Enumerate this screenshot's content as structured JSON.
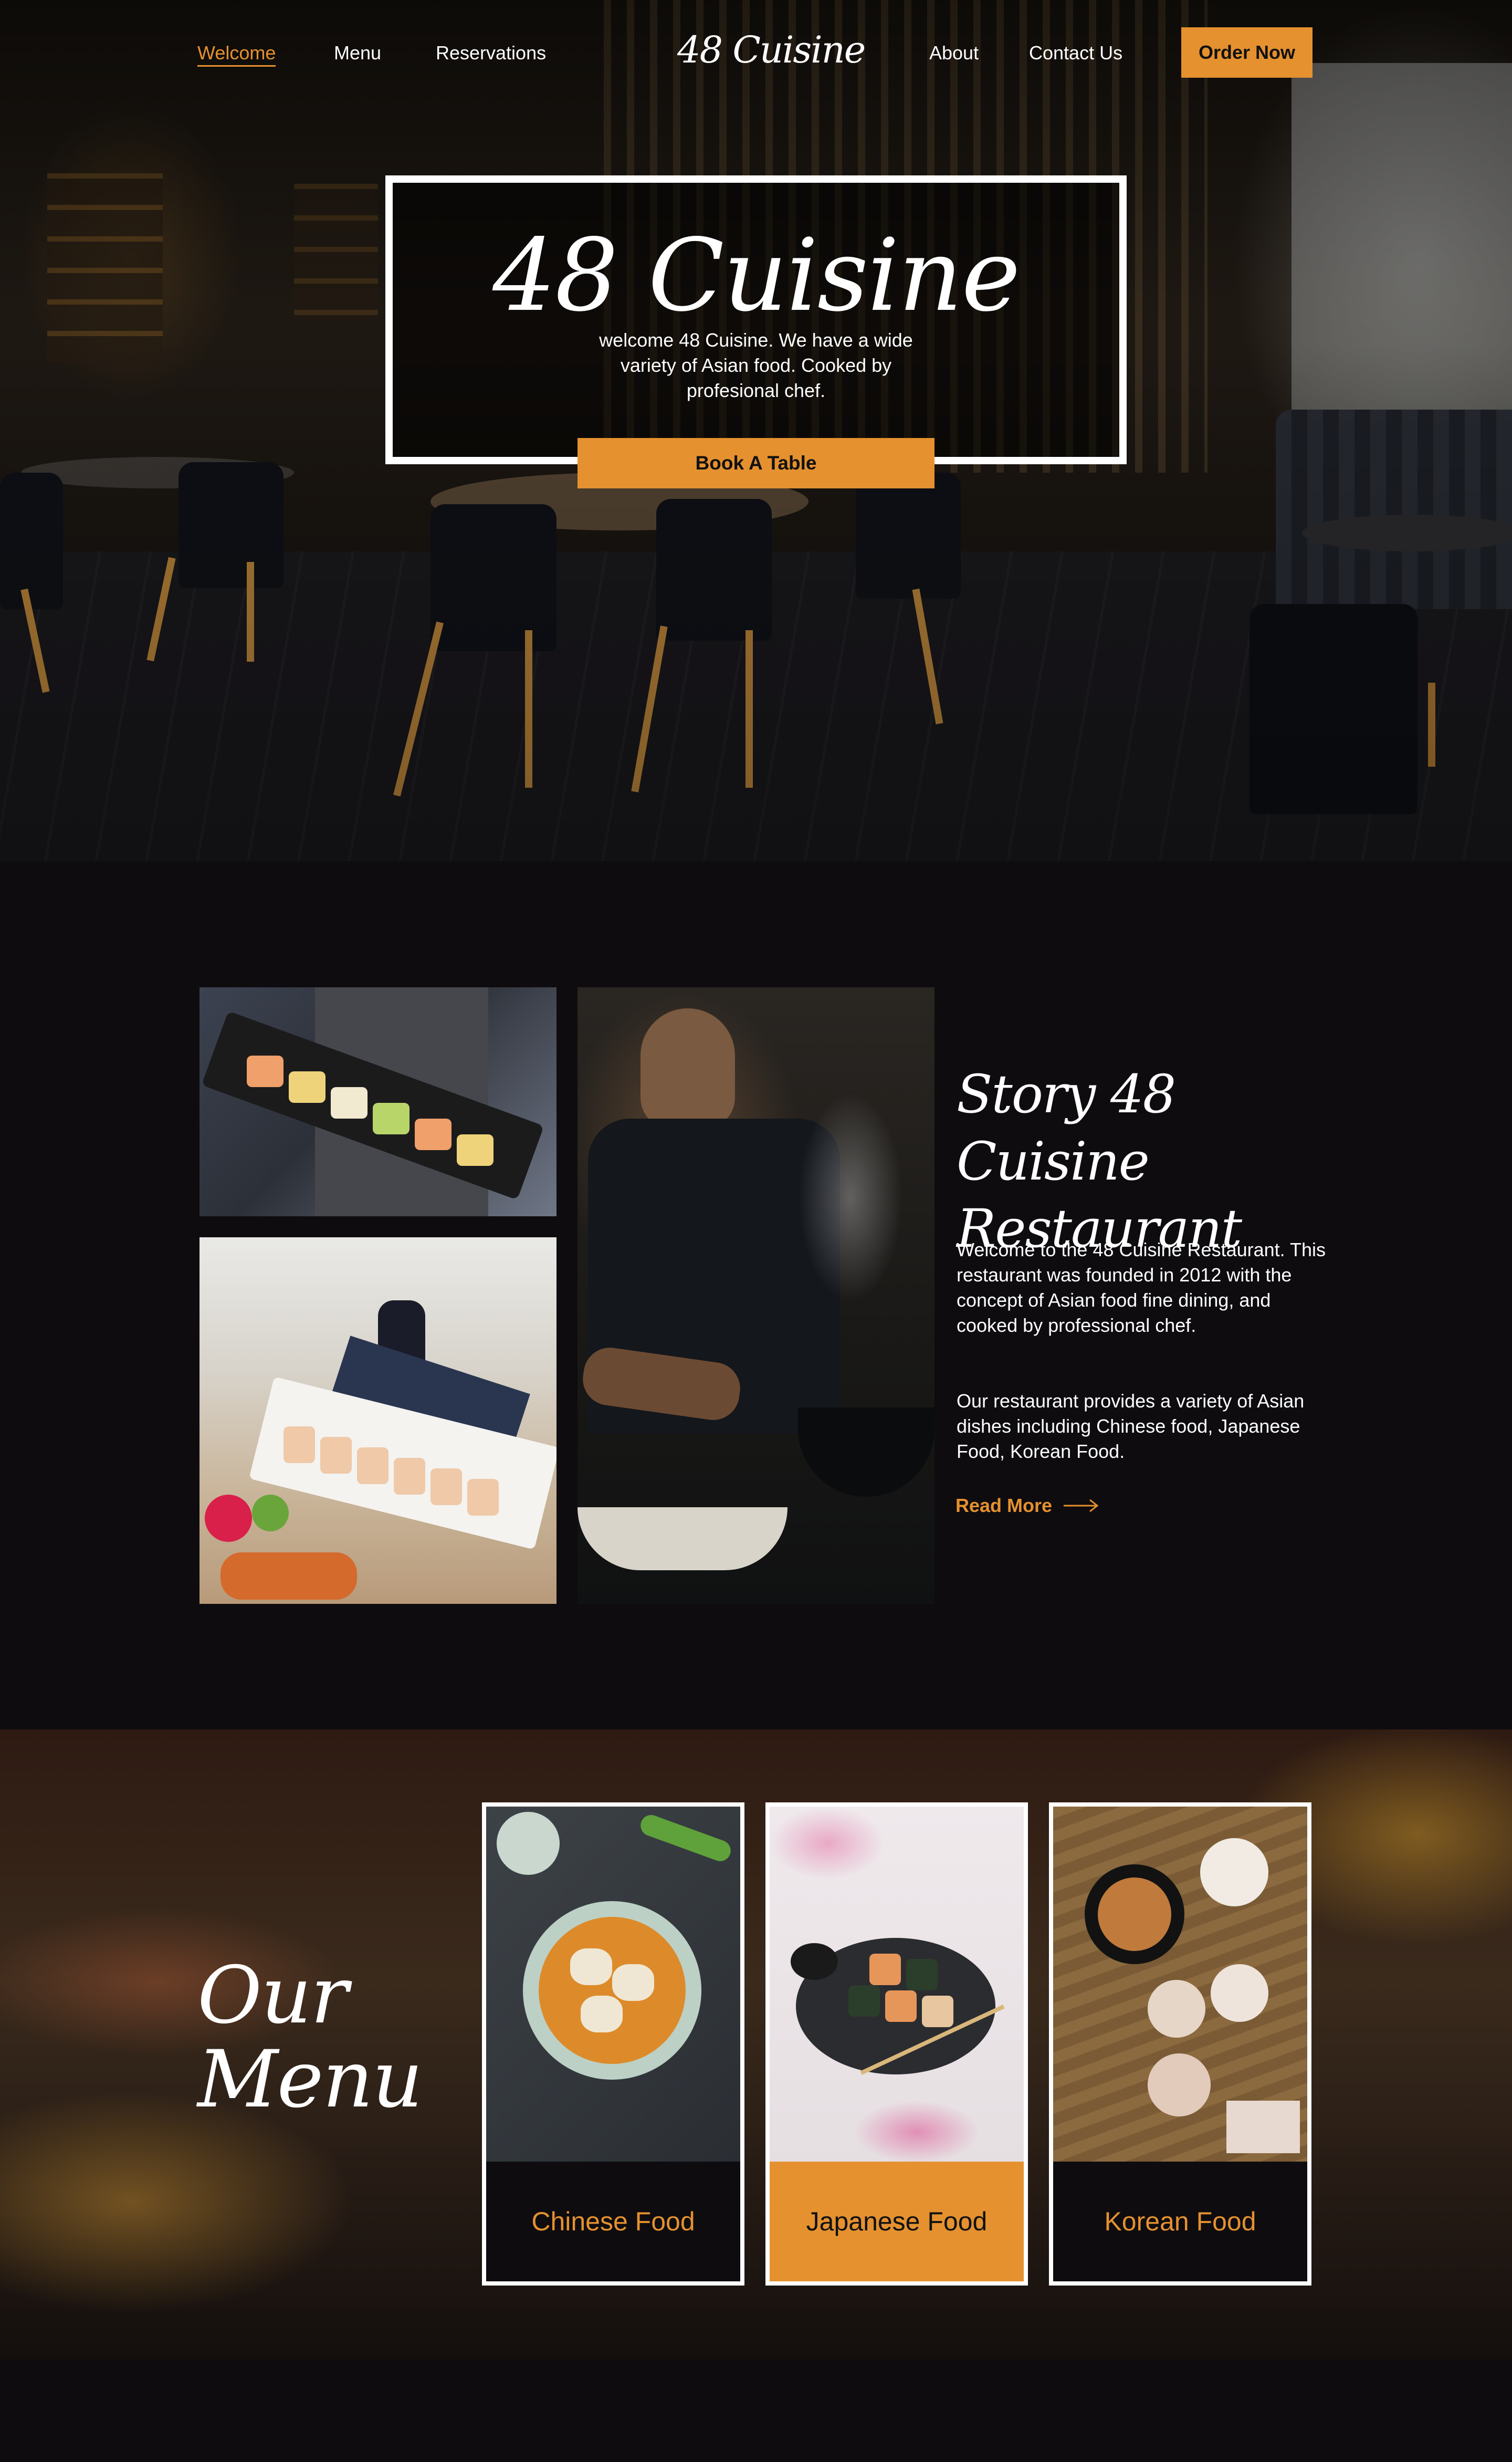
{
  "nav": {
    "links": [
      {
        "label": "Welcome",
        "active": true
      },
      {
        "label": "Menu",
        "active": false
      },
      {
        "label": "Reservations",
        "active": false
      },
      {
        "label": "About",
        "active": false
      },
      {
        "label": "Contact Us",
        "active": false
      }
    ],
    "logo": "48 Cuisine",
    "order_button": "Order Now"
  },
  "hero": {
    "title": "48 Cuisine",
    "description": "welcome 48 Cuisine. We have a wide variety of Asian  food. Cooked by profesional chef.",
    "book_button": "Book A Table"
  },
  "story": {
    "title": "Story 48 Cuisine Restaurant",
    "paragraph1": "Welcome to  the 48 Cuisine Restaurant. This restaurant was founded in 2012 with the concept of Asian food fine dining, and cooked by professional chef.",
    "paragraph2": "Our restaurant provides a variety of Asian dishes including Chinese food, Japanese Food, Korean Food.",
    "read_more": "Read More"
  },
  "menu": {
    "title_line1": "Our",
    "title_line2": "Menu",
    "cards": [
      {
        "label": "Chinese Food",
        "highlighted": false
      },
      {
        "label": "Japanese Food",
        "highlighted": true
      },
      {
        "label": "Korean Food",
        "highlighted": false
      }
    ]
  },
  "colors": {
    "accent": "#e5912f",
    "background": "#0e0c0f",
    "text": "#ffffff"
  }
}
